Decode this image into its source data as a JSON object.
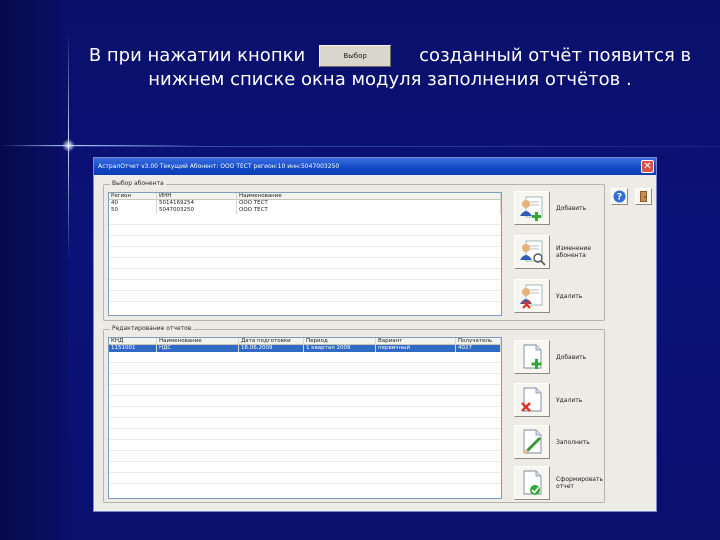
{
  "caption": {
    "before_button": "В при нажатии кнопки",
    "button_label": "Выбор",
    "after_button": "созданный отчёт появится в",
    "line2": "нижнем списке окна модуля заполнения отчётов ."
  },
  "window": {
    "title": "АстралОтчет v3.00 Текущий Абонент: ООО ТЕСТ регион:10 инн:5047003250",
    "close_glyph": "✕"
  },
  "subscribers": {
    "group_title": "Выбор абонента",
    "columns": [
      "Регион",
      "ИНН",
      "Наименование"
    ],
    "rows": [
      [
        "40",
        "5014169254",
        "ООО ТЕСТ"
      ],
      [
        "50",
        "5047003250",
        "ООО ТЕСТ"
      ]
    ],
    "buttons": [
      {
        "label": "Добавить",
        "icon": "add-user-icon"
      },
      {
        "label": "Изменение абонента",
        "icon": "edit-user-icon"
      },
      {
        "label": "Удалить",
        "icon": "delete-user-icon"
      }
    ]
  },
  "reports": {
    "group_title": "Редактирование отчетов",
    "columns": [
      "КНД",
      "Наименование",
      "Дата подготовки",
      "Период",
      "Вариант",
      "Получатель"
    ],
    "rows": [
      [
        "1151001",
        "НДС",
        "16.06.2009",
        "1 квартал 2009",
        "первичный",
        "4027"
      ]
    ],
    "buttons": [
      {
        "label": "Добавить",
        "icon": "add-document-icon"
      },
      {
        "label": "Удалить",
        "icon": "delete-document-icon"
      },
      {
        "label": "Заполнить",
        "icon": "fill-document-icon"
      },
      {
        "label": "Сформировать отчет",
        "icon": "generate-document-icon"
      }
    ]
  },
  "toolbar": {
    "help_icon": "help-icon",
    "exit_icon": "exit-icon"
  },
  "colors": {
    "background": "#0b1278",
    "window": "#ecebe6",
    "selection": "#316ac5",
    "titlebar": "#1247c5"
  }
}
